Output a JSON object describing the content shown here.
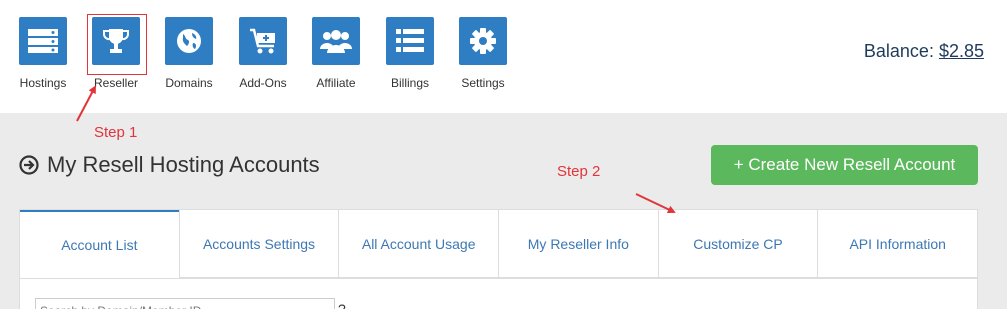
{
  "nav": [
    {
      "label": "Hostings",
      "icon": "server-icon"
    },
    {
      "label": "Reseller",
      "icon": "trophy-icon"
    },
    {
      "label": "Domains",
      "icon": "globe-icon"
    },
    {
      "label": "Add-Ons",
      "icon": "cart-plus-icon"
    },
    {
      "label": "Affiliate",
      "icon": "users-icon"
    },
    {
      "label": "Billings",
      "icon": "list-icon"
    },
    {
      "label": "Settings",
      "icon": "gear-icon"
    }
  ],
  "balance": {
    "label": "Balance: ",
    "amount": "$2.85"
  },
  "annotations": {
    "step1": "Step 1",
    "step2": "Step 2",
    "color": "#e0353b"
  },
  "page_title": "My Resell Hosting Accounts",
  "create_button": "+ Create New Resell Account",
  "tabs": [
    "Account List",
    "Accounts Settings",
    "All Account Usage",
    "My Reseller Info",
    "Customize CP",
    "API Information"
  ],
  "search": {
    "placeholder": "Search by Domain/Member ID",
    "help": "?"
  },
  "colors": {
    "brand": "#2f7dc2",
    "success": "#5cb85c",
    "link": "#3c78b4"
  }
}
